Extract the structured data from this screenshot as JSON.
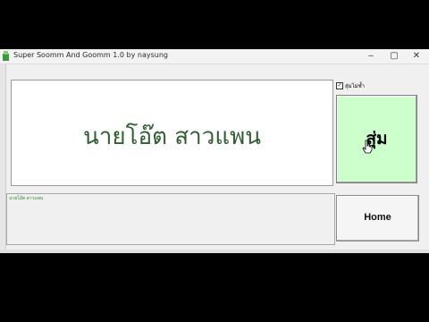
{
  "window": {
    "title": "Super Soomm And Goomm 1.0  by naysung",
    "controls": {
      "minimize": "‒",
      "maximize": "▢",
      "close": "✕"
    }
  },
  "display": {
    "text": "นายโอ๊ต สาวแพน"
  },
  "options": {
    "no_repeat_label": "สุ่มไม่ซ้ำ",
    "no_repeat_checked": true
  },
  "buttons": {
    "random_label": "สุ่ม",
    "home_label": "Home"
  },
  "log": {
    "text": "นายโอ๊ต สาวแพน"
  },
  "colors": {
    "display_text": "#2e5e2e",
    "random_button_bg": "#ccffcc",
    "log_text": "#2e8b2e"
  },
  "icons": {
    "app": "app-icon",
    "cursor": "hand-cursor-icon"
  }
}
